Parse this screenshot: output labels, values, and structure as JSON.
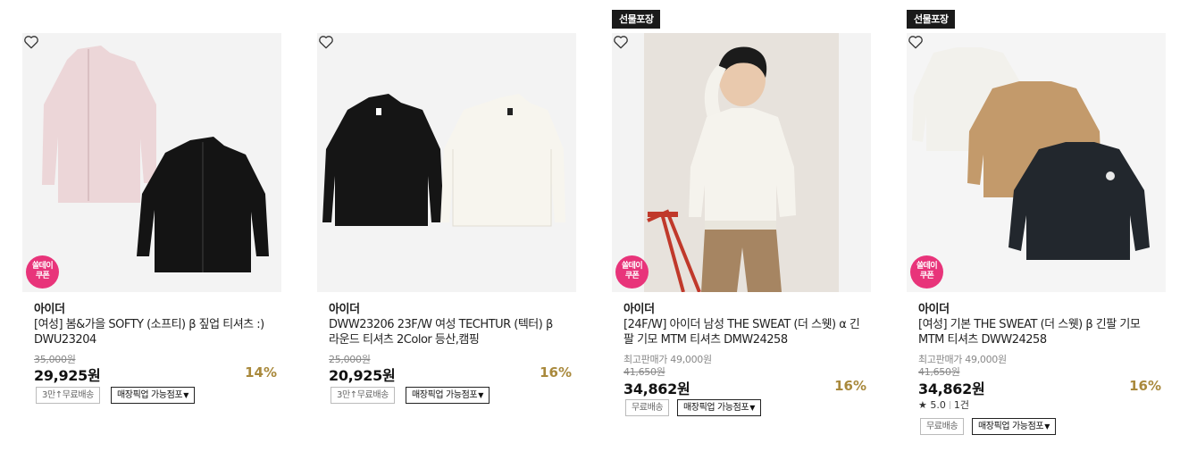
{
  "products": [
    {
      "brand": "아이더",
      "name": "[여성] 봄&가을 SOFTY (소프티) β 짚업 티셔츠 :) DWU23204",
      "original_price": "35,000원",
      "price": "29,925원",
      "discount": "14%",
      "coupon_line1": "쏠데이",
      "coupon_line2": "쿠폰",
      "chips": [
        "3만↑무료배송",
        "매장픽업 가능점포"
      ],
      "caret": "▼"
    },
    {
      "brand": "아이더",
      "name": "DWW23206 23F/W 여성 TECHTUR (텍터) β 라운드 티셔츠 2Color 등산,캠핑",
      "original_price": "25,000원",
      "price": "20,925원",
      "discount": "16%",
      "chips": [
        "3만↑무료배송",
        "매장픽업 가능점포"
      ],
      "caret": "▼"
    },
    {
      "tag": "선물포장",
      "brand": "아이더",
      "name": "[24F/W] 아이더 남성 THE SWEAT (더 스웻) α 긴팔 기모 MTM 티셔츠 DMW24258",
      "max_price": "최고판매가 49,000원",
      "original_price": "41,650원",
      "price": "34,862원",
      "discount": "16%",
      "coupon_line1": "쏠데이",
      "coupon_line2": "쿠폰",
      "chips": [
        "무료배송",
        "매장픽업 가능점포"
      ],
      "caret": "▼"
    },
    {
      "tag": "선물포장",
      "brand": "아이더",
      "name": "[여성] 기본 THE SWEAT (더 스웻) β 긴팔 기모 MTM 티셔츠 DWW24258",
      "max_price": "최고판매가 49,000원",
      "original_price": "41,650원",
      "price": "34,862원",
      "discount": "16%",
      "coupon_line1": "쏠데이",
      "coupon_line2": "쿠폰",
      "rating": "5.0",
      "review_count": "1건",
      "chips": [
        "무료배송",
        "매장픽업 가능점포"
      ],
      "caret": "▼"
    }
  ],
  "icons": {
    "wish": "heart-outline-icon",
    "star": "star-icon",
    "coupon": "coupon-badge-icon"
  },
  "colors": {
    "discount": "#a9893c",
    "coupon_badge": "#e8347a",
    "gift_tag_bg": "#1a1a1a"
  }
}
